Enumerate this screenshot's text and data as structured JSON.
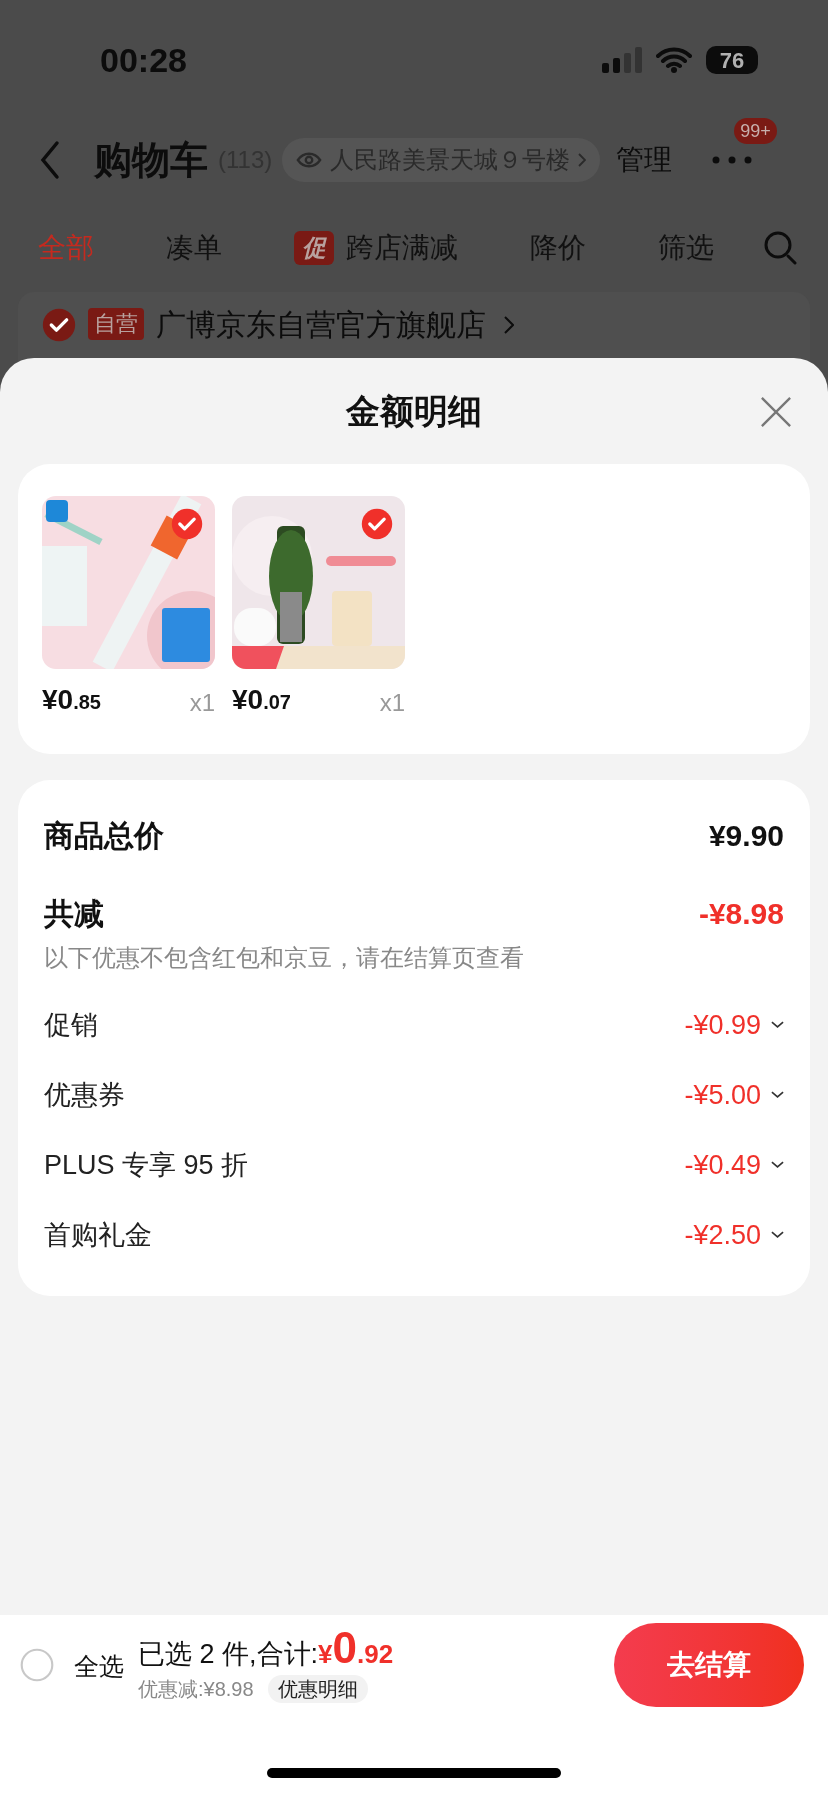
{
  "status_bar": {
    "time": "00:28",
    "battery": "76"
  },
  "nav": {
    "title": "购物车",
    "count": "(113)",
    "address": "人民路美景天城９号楼",
    "manage": "管理",
    "badge": "99+"
  },
  "tabs": [
    {
      "label": "全部",
      "selected": true
    },
    {
      "label": "凑单",
      "selected": false
    },
    {
      "label": "跨店满减",
      "tag": "促",
      "selected": false
    },
    {
      "label": "降价",
      "selected": false
    },
    {
      "label": "筛选",
      "selected": false
    }
  ],
  "store": {
    "checked": true,
    "tag": "自营",
    "name": "广博京东自营官方旗舰店"
  },
  "sheet": {
    "title": "金额明细",
    "products": [
      {
        "kind": "picture",
        "checked": true,
        "price": "¥0.85",
        "quantity": "x1"
      },
      {
        "kind": "picture",
        "checked": true,
        "price": "¥0.07",
        "quantity": "x1"
      }
    ],
    "total": {
      "label": "商品总价",
      "value": "¥9.90"
    },
    "reduction": {
      "label": "共减",
      "value": "-¥8.98",
      "note": "以下优惠不包含红包和京豆，请在结算页查看"
    },
    "discounts": [
      {
        "label": "促销",
        "value": "-¥0.99"
      },
      {
        "label": "优惠券",
        "value": "-¥5.00"
      },
      {
        "label": "PLUS 专享 95 折",
        "value": "-¥0.49"
      },
      {
        "label": "首购礼金",
        "value": "-¥2.50"
      }
    ]
  },
  "footer": {
    "select_all": {
      "label": "全选",
      "checked": false
    },
    "summary": "已选 2 件,合计:",
    "total": "¥0.92",
    "saved": "优惠减:¥8.98",
    "details": "优惠明细",
    "checkout": "去结算"
  }
}
